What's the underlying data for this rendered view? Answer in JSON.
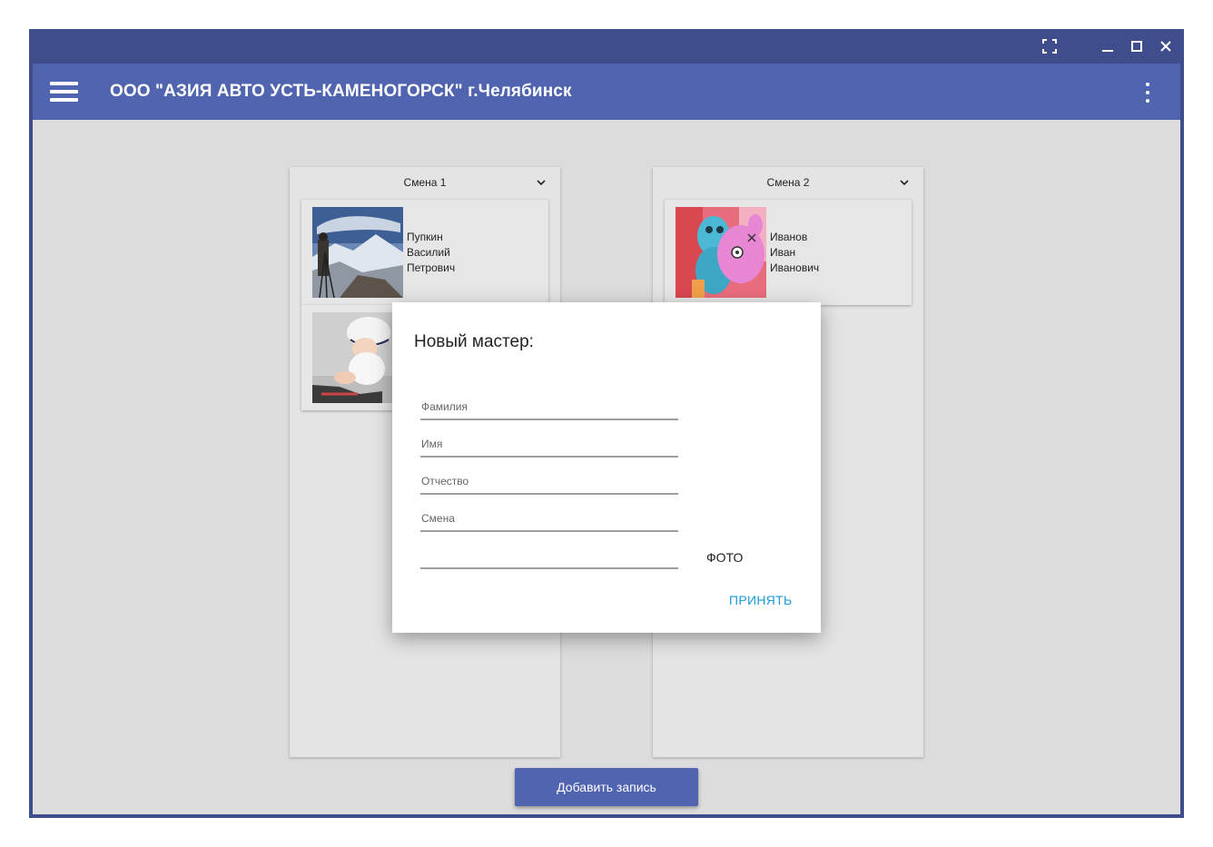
{
  "window": {
    "controls": [
      "fullscreen-icon",
      "minimize-icon",
      "maximize-icon",
      "close-icon"
    ]
  },
  "appbar": {
    "title": "ООО \"АЗИЯ АВТО УСТЬ-КАМЕНОГОРСК\" г.Челябинск"
  },
  "columns": [
    {
      "title": "Смена 1",
      "cards": [
        {
          "name": [
            "Пупкин",
            "Василий",
            "Петрович"
          ],
          "photo": "mountain-photographer"
        },
        {
          "name": [
            "",
            "",
            ""
          ],
          "photo": "baby-in-cap"
        }
      ]
    },
    {
      "title": "Смена 2",
      "cards": [
        {
          "name": [
            "Иванов",
            "Иван",
            "Иванович"
          ],
          "photo": "toy-monsters"
        }
      ]
    }
  ],
  "add_button": "Добавить запись",
  "dialog": {
    "title": "Новый мастер:",
    "fields": [
      {
        "placeholder": "Фамилия"
      },
      {
        "placeholder": "Имя"
      },
      {
        "placeholder": "Отчество"
      },
      {
        "placeholder": "Смена"
      },
      {
        "placeholder": ""
      }
    ],
    "photo_button": "ФОТО",
    "accept_button": "ПРИНЯТЬ"
  },
  "colors": {
    "window_frame": "#3f4d8c",
    "appbar": "#5064b0",
    "background": "#dcdcdc",
    "accent_link": "#1a9ad6"
  }
}
